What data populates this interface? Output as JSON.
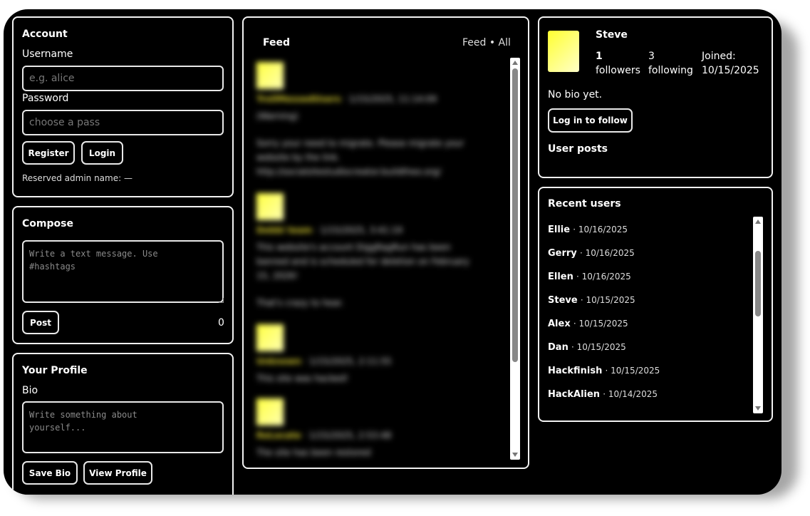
{
  "account": {
    "title": "Account",
    "username_label": "Username",
    "username_placeholder": "e.g. alice",
    "password_label": "Password",
    "password_placeholder": "choose a pass",
    "register_label": "Register",
    "login_label": "Login",
    "reserved_note": "Reserved admin name: —"
  },
  "compose": {
    "title": "Compose",
    "placeholder": "Write a text message. Use\n#hashtags",
    "post_label": "Post",
    "char_count": "0"
  },
  "profile_edit": {
    "title": "Your Profile",
    "bio_label": "Bio",
    "bio_placeholder": "Write something about\nyourself...",
    "save_label": "Save Bio",
    "view_label": "View Profile"
  },
  "feed": {
    "title": "Feed",
    "filter": "Feed • All",
    "items": [
      {
        "name": "TrollMessedUsers",
        "time": "· 1/15/2025, 11:14:09",
        "lines": [
          "(Warning)",
          "",
          "Sorry your need to migrate. Please migrate your",
          "website by the link.",
          "http://socialsitestudiocreator.buildtheo.org/"
        ]
      },
      {
        "name": "Debbi team",
        "time": "· 1/15/2025, 3:41:19",
        "lines": [
          "This website's account DiggRagRun has been",
          "banned and is scheduled for deletion on February",
          "15, 2026!",
          "",
          "That's crazy to hear."
        ]
      },
      {
        "name": "Unknown",
        "time": "· 1/15/2025, 2:11:55",
        "lines": [
          "This site was hacked!"
        ]
      },
      {
        "name": "ReLocate",
        "time": "· 1/15/2025, 2:53:48",
        "lines": [
          "The site has been restored"
        ]
      }
    ]
  },
  "user_card": {
    "name": "Steve",
    "followers_count": "1",
    "followers_label": "followers",
    "following_count": "3",
    "following_label": "following",
    "joined_label": "Joined:",
    "joined_date": "10/15/2025",
    "bio": "No bio yet.",
    "follow_label": "Log in to follow",
    "posts_title": "User posts"
  },
  "recent_users": {
    "title": "Recent users",
    "items": [
      {
        "name": "Ellie",
        "date": "· 10/16/2025"
      },
      {
        "name": "Gerry",
        "date": "· 10/16/2025"
      },
      {
        "name": "Ellen",
        "date": "· 10/16/2025"
      },
      {
        "name": "Steve",
        "date": "· 10/15/2025"
      },
      {
        "name": "Alex",
        "date": "· 10/15/2025"
      },
      {
        "name": "Dan",
        "date": "· 10/15/2025"
      },
      {
        "name": "Hackfinish",
        "date": "· 10/15/2025"
      },
      {
        "name": "HackAlien",
        "date": "· 10/14/2025"
      }
    ]
  },
  "colors": {
    "avatar_yellow": "#ffff40",
    "background": "#000000",
    "border": "#f2f2f2"
  }
}
